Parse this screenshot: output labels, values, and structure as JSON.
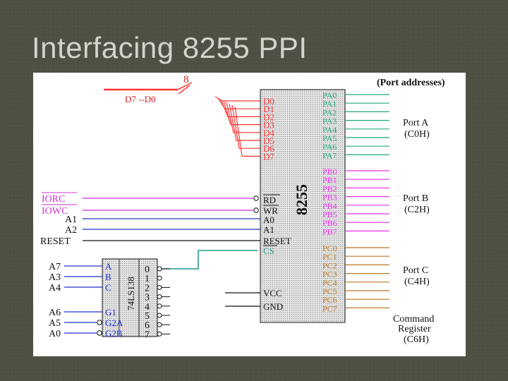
{
  "title": "Interfacing 8255 PPI",
  "bus_width": "8",
  "bus_label": "D7 --D0",
  "port_addresses_heading": "(Port   addresses)",
  "chip_8255": {
    "name": "8255",
    "data_pins": [
      "D0",
      "D1",
      "D2",
      "D3",
      "D4",
      "D5",
      "D6",
      "D7"
    ],
    "control_pins": [
      "RD",
      "WR",
      "A0",
      "A1",
      "RESET",
      "CS"
    ],
    "power_pins": [
      "VCC",
      "GND"
    ],
    "port_a_pins": [
      "PA0",
      "PA1",
      "PA2",
      "PA3",
      "PA4",
      "PA5",
      "PA6",
      "PA7"
    ],
    "port_b_pins": [
      "PB0",
      "PB1",
      "PB2",
      "PB3",
      "PB4",
      "PB5",
      "PB6",
      "PB7"
    ],
    "port_c_pins": [
      "PC0",
      "PC1",
      "PC2",
      "PC3",
      "PC4",
      "PC5",
      "PC6",
      "PC7"
    ]
  },
  "signals_left": [
    "IORC",
    "IOWC",
    "A1",
    "A2",
    "RESET"
  ],
  "decoder": {
    "name": "74LS138",
    "select_inputs": [
      "A",
      "B",
      "C"
    ],
    "enable_inputs": [
      "G1",
      "G2A",
      "G2B"
    ],
    "outputs": [
      "0",
      "1",
      "2",
      "3",
      "4",
      "5",
      "6",
      "7"
    ]
  },
  "decoder_address_lines_top": [
    "A7",
    "A3",
    "A4"
  ],
  "decoder_address_lines_bottom": [
    "A6",
    "A5",
    "A0"
  ],
  "ports": [
    {
      "name": "Port  A",
      "address": "(C0H)"
    },
    {
      "name": "Port  B",
      "address": "(C2H)"
    },
    {
      "name": "Port  C",
      "address": "(C4H)"
    }
  ],
  "command_register": {
    "line1": "Command",
    "line2": "Register",
    "address": "(C6H)"
  },
  "colors": {
    "bus_red": "#ff3333",
    "port_a_green": "#22aa77",
    "port_b_magenta": "#ee33ee",
    "port_c_brown": "#bb7722",
    "address_blue": "#2233cc",
    "control_magenta": "#cc33cc",
    "cs_teal": "#229988",
    "chip_fill": "#d8d8d8"
  }
}
